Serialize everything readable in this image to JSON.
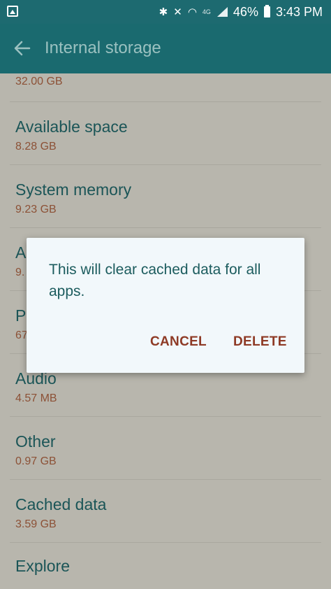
{
  "status_bar": {
    "battery": "46%",
    "time": "3:43 PM",
    "network": "4G"
  },
  "app_bar": {
    "title": "Internal storage"
  },
  "list": [
    {
      "title": "",
      "value": "32.00 GB"
    },
    {
      "title": "Available space",
      "value": "8.28 GB"
    },
    {
      "title": "System memory",
      "value": "9.23 GB"
    },
    {
      "title": "A",
      "value": "9."
    },
    {
      "title": "P",
      "value": "67"
    },
    {
      "title": "Audio",
      "value": "4.57 MB"
    },
    {
      "title": "Other",
      "value": "0.97 GB"
    },
    {
      "title": "Cached data",
      "value": "3.59 GB"
    },
    {
      "title": "Explore",
      "value": ""
    }
  ],
  "dialog": {
    "message": "This will clear cached data for all apps.",
    "cancel_label": "CANCEL",
    "delete_label": "DELETE"
  },
  "colors": {
    "app_bar": "#1a6a6f",
    "title_text": "#1b5557",
    "value_text": "#8c5136",
    "dialog_button": "#8e3a25"
  }
}
